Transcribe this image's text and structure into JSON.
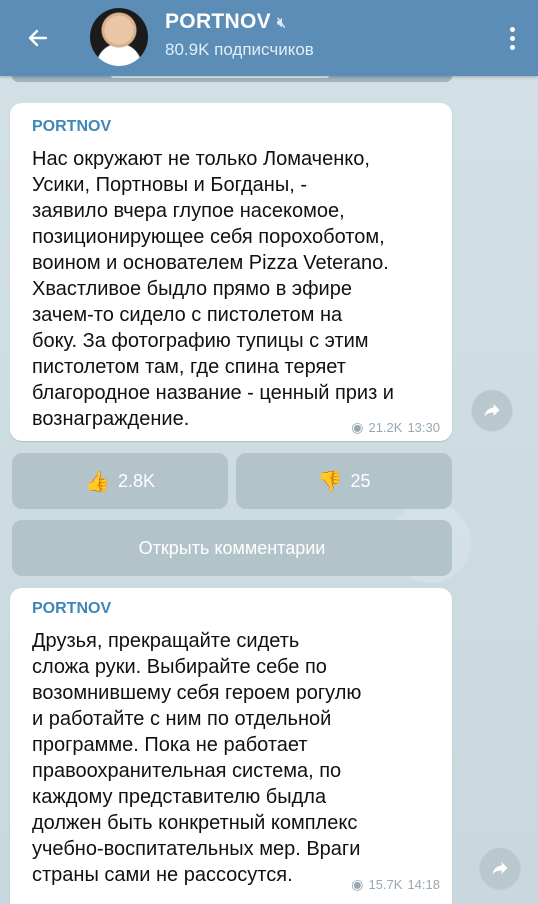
{
  "header": {
    "title": "PORTNOV",
    "mute_icon": "mute-icon",
    "subtitle": "80.9K подписчиков"
  },
  "post1": {
    "sender": "PORTNOV",
    "text": "Нас окружают не только Ломаченко,\nУсики, Портновы и Богданы, -\nзаявило вчера глупое насекомое,\nпозиционирующее себя порохоботом,\nвоином и основателем Pizza Veterano.\nХвастливое быдло прямо в эфире\nзачем-то сидело с пистолетом на\nбоку. За фотографию тупицы с этим\nпистолетом там, где спина теряет\nблагородное название - ценный приз и\nвознаграждение.",
    "views": "21.2K",
    "time": "13:30"
  },
  "reactions": {
    "like_count": "2.8K",
    "dislike_count": "25"
  },
  "comments": {
    "label": "Открыть комментарии"
  },
  "post2": {
    "sender": "PORTNOV",
    "text": "Друзья, прекращайте сидеть\nсложа руки. Выбирайте себе по\nвозомнившему себя героем рогулю\nи работайте с ним по отдельной\nпрограмме. Пока не работает\nправоохранительная система, по\nкаждому представителю быдла\nдолжен быть конкретный комплекс\nучебно-воспитательных мер. Враги\nстраны сами не рассосутся.",
    "views": "15.7K",
    "time": "14:18"
  },
  "colors": {
    "header": "#5b8db6",
    "sender": "#3e86b7",
    "button": "#b3c3ca"
  }
}
